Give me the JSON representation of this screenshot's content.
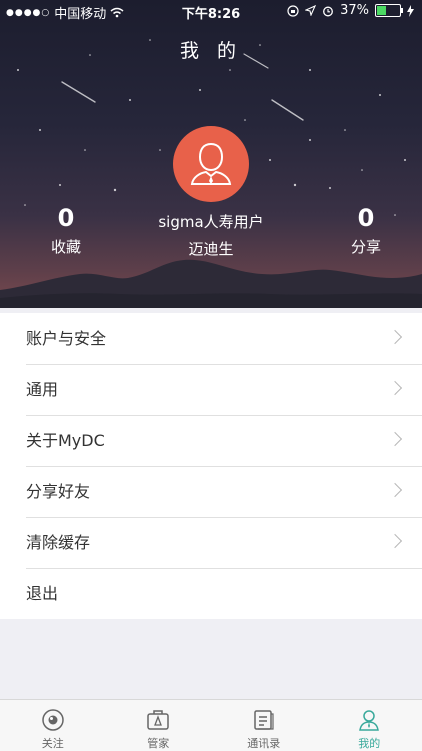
{
  "status_bar": {
    "carrier": "中国移动",
    "time": "下午8:26",
    "battery_text": "37%",
    "battery_level": 0.37
  },
  "header": {
    "title": "我 的"
  },
  "profile": {
    "name": "sigma人寿用户",
    "subtitle": "迈迪生",
    "favorites_count": "0",
    "favorites_label": "收藏",
    "shares_count": "0",
    "shares_label": "分享"
  },
  "menu": {
    "items": [
      {
        "label": "账户与安全",
        "chevron": true
      },
      {
        "label": "通用",
        "chevron": true
      },
      {
        "label": "关于MyDC",
        "chevron": true
      },
      {
        "label": "分享好友",
        "chevron": true
      },
      {
        "label": "清除缓存",
        "chevron": true
      },
      {
        "label": "退出",
        "chevron": false
      }
    ]
  },
  "tabbar": {
    "tabs": [
      {
        "label": "关注",
        "icon": "eye-icon"
      },
      {
        "label": "管家",
        "icon": "briefcase-icon"
      },
      {
        "label": "通讯录",
        "icon": "contacts-icon"
      },
      {
        "label": "我的",
        "icon": "person-icon",
        "active": true
      }
    ],
    "accent": "#39a99b"
  },
  "colors": {
    "avatar_bg": "#e8614a",
    "accent": "#39a99b"
  }
}
